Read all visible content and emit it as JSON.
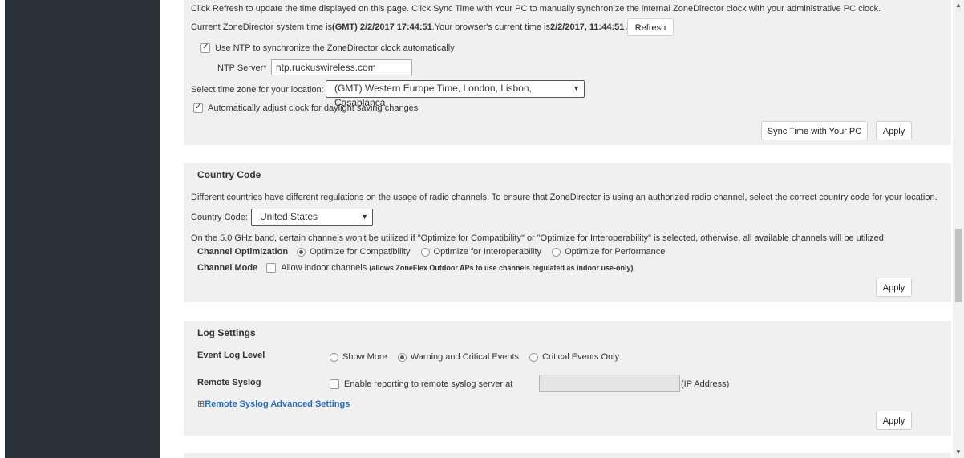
{
  "time": {
    "intro": "Click Refresh to update the time displayed on this page. Click Sync Time with Your PC to manually synchronize the internal ZoneDirector clock with your administrative PC clock.",
    "current_prefix": "Current ZoneDirector system time is",
    "current_value": "(GMT) 2/2/2017 17:44:51",
    "browser_prefix": ".Your browser's current time is",
    "browser_value": "2/2/2017, 11:44:51 AM",
    "refresh_button": "Refresh",
    "ntp_checkbox_label": "Use NTP to synchronize the ZoneDirector clock automatically",
    "ntp_checked": true,
    "ntp_server_label": "NTP Server*",
    "ntp_server_value": "ntp.ruckuswireless.com",
    "timezone_label": "Select time zone for your location:",
    "timezone_value": "(GMT) Western Europe Time, London, Lisbon, Casablanca",
    "dst_label": "Automatically adjust clock for daylight saving changes",
    "dst_checked": true,
    "sync_button": "Sync Time with Your PC",
    "apply_button": "Apply"
  },
  "country": {
    "title": "Country Code",
    "description": "Different countries have different regulations on the usage of radio channels. To ensure that ZoneDirector is using an authorized radio channel, select the correct country code for your location.",
    "code_label": "Country Code:",
    "code_value": "United States",
    "band_note": "On the 5.0 GHz band, certain channels won't be utilized if \"Optimize for Compatibility\" or \"Optimize for Interoperability\" is selected, otherwise, all available channels will be utilized.",
    "optimization_label": "Channel Optimization",
    "optimization_options": [
      "Optimize for Compatibility",
      "Optimize for Interoperability",
      "Optimize for Performance"
    ],
    "optimization_selected": "Optimize for Compatibility",
    "mode_label": "Channel Mode",
    "mode_checkbox_label": "Allow indoor channels",
    "mode_note": "(allows ZoneFlex Outdoor APs to use channels regulated as indoor use-only)",
    "apply_button": "Apply"
  },
  "log": {
    "title": "Log Settings",
    "event_label": "Event Log Level",
    "event_options": [
      "Show More",
      "Warning and Critical Events",
      "Critical Events Only"
    ],
    "event_selected": "Warning and Critical Events",
    "syslog_label": "Remote Syslog",
    "syslog_checkbox_label": "Enable reporting to remote syslog server at",
    "syslog_ip_value": "",
    "syslog_ip_suffix": "(IP Address)",
    "advanced_prefix": "⊞",
    "advanced_link": "Remote Syslog Advanced Settings",
    "apply_button": "Apply"
  },
  "colors": {
    "sidebar": "#2b323a",
    "panel": "#f0f0f0",
    "link": "#2a6ebb"
  }
}
